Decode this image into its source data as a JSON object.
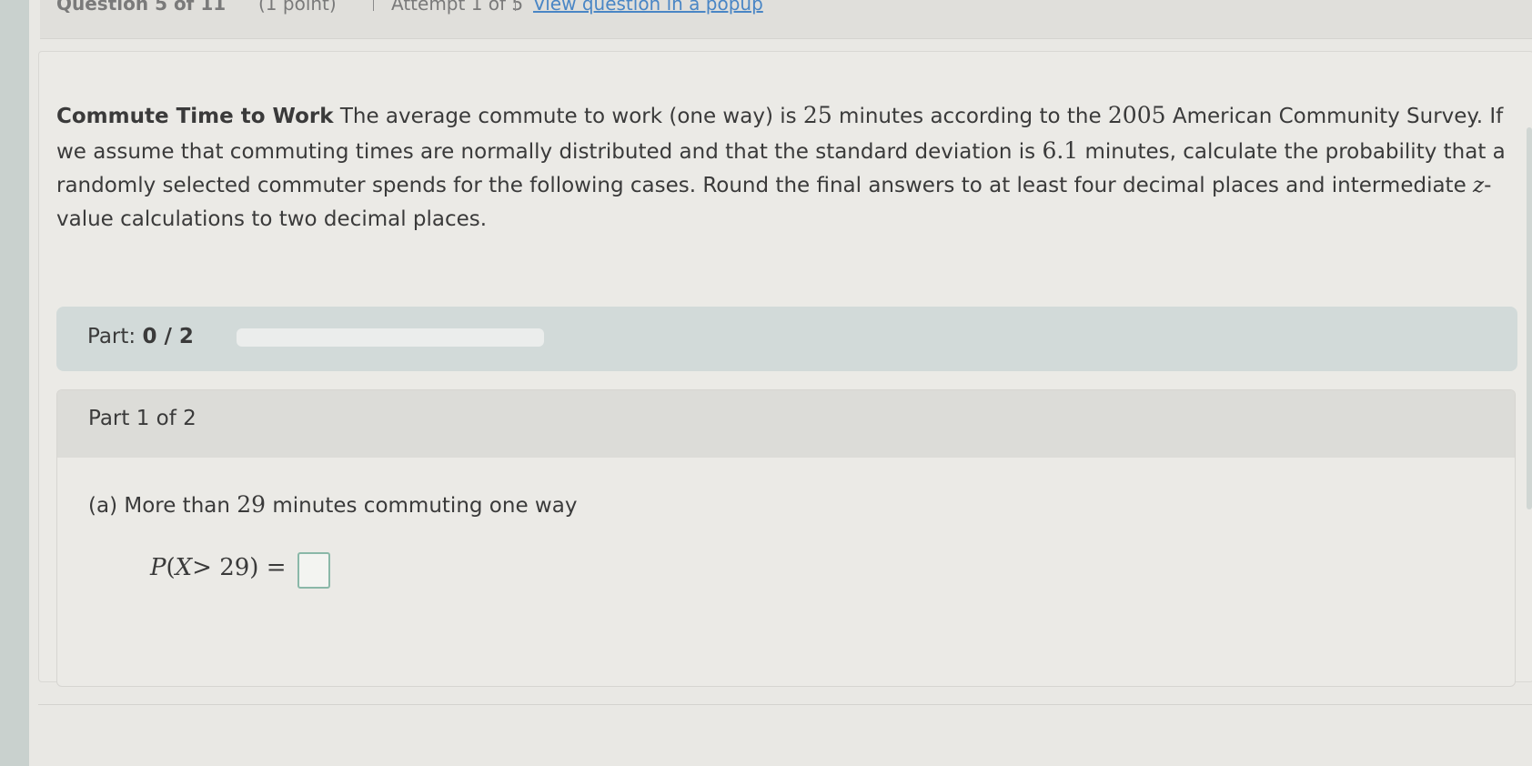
{
  "header": {
    "question_counter": "Question 5 of 11",
    "points": "(1 point)",
    "attempt": "Attempt 1 of 5",
    "popup_link": "View question in a popup"
  },
  "question": {
    "title": "Commute Time to Work",
    "text_1": " The average commute to work (one way) is ",
    "mean": "25",
    "text_2": " minutes according to the ",
    "year": "2005",
    "text_3": " American Community Survey. If we assume that commuting times are normally distributed and that the standard deviation is ",
    "sd": "6.1",
    "text_4": " minutes, calculate the probability that a randomly selected commuter spends for the following cases. Round the final answers to at least four decimal places and intermediate ",
    "z_var": "z",
    "text_5": "-value calculations to two decimal places."
  },
  "progress": {
    "label": "Part:",
    "value": "0 / 2",
    "fraction": 0
  },
  "part": {
    "header": "Part 1 of 2",
    "sub_label": "(a) More than ",
    "sub_num": "29",
    "sub_rest": " minutes commuting one way",
    "eq_p": "P",
    "eq_open": "(",
    "eq_x": "X",
    "eq_rest": "> 29) =",
    "answer_value": ""
  }
}
